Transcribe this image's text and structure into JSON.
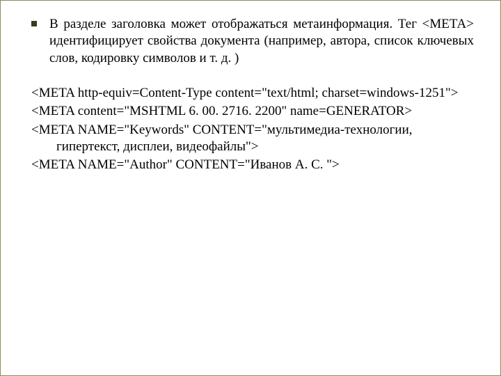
{
  "bullet": {
    "text": "В разделе заголовка может отображаться метаинформация. Тег <МЕТА> идентифицирует свойства документа (например, автора, список ключевых слов, кодировку символов и т. д. )"
  },
  "code": {
    "lines": [
      "<META http-equiv=Content-Type content=\"text/html; charset=windows-1251\">",
      "<META content=\"MSHTML 6. 00. 2716. 2200\" name=GENERATOR>",
      "<META NAME=\"Keywords\" CONTENT=\"мультимедиа-технологии, гипертекст, дисплеи, видеофайлы\">",
      "<META NAME=\"Author\" CONTENT=\"Иванов А. С. \">"
    ]
  }
}
